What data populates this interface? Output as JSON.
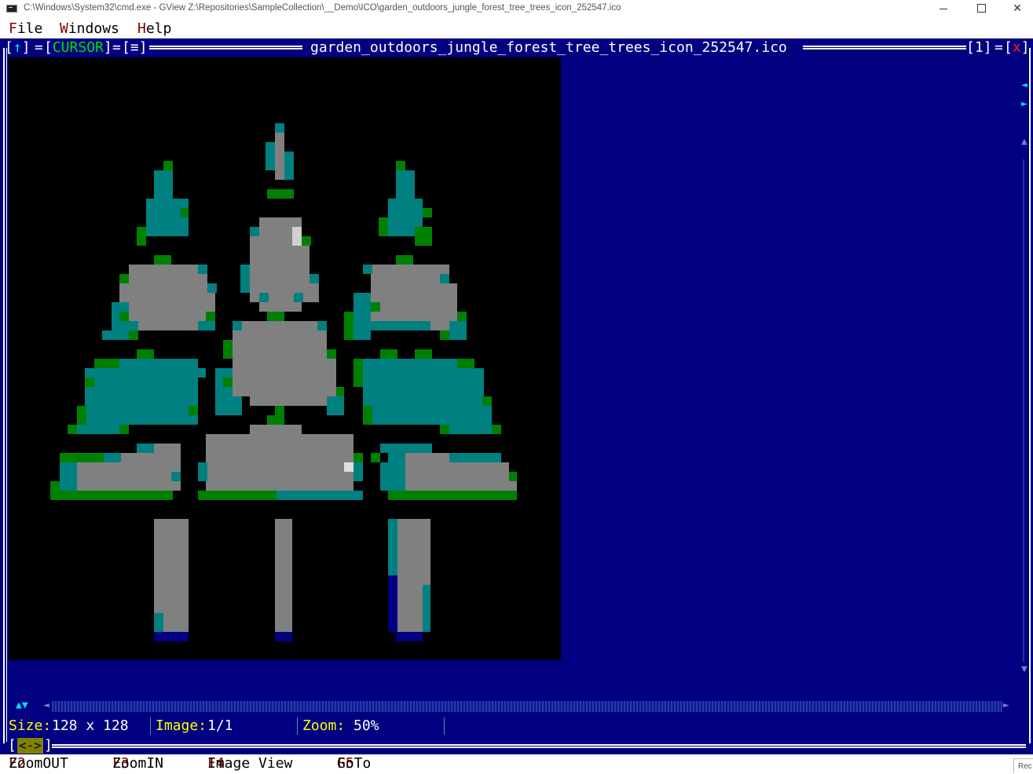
{
  "window": {
    "title": "C:\\Windows\\System32\\cmd.exe - GView  Z:\\Repositories\\SampleCollection\\__Demo\\ICO\\garden_outdoors_jungle_forest_tree_trees_icon_252547.ico",
    "minimize_glyph": "—",
    "maximize_glyph": "",
    "close_glyph": "✕"
  },
  "menu": {
    "file_hot": "F",
    "file_rest": "ile",
    "windows_hot": "W",
    "windows_rest": "indows",
    "help_hot": "H",
    "help_rest": "elp"
  },
  "viewer": {
    "btn_up": "↑",
    "btn_cursor": "CURSOR",
    "btn_menu": "≡",
    "file_name": "garden_outdoors_jungle_forest_tree_trees_icon_252547.ico",
    "window_number": "1",
    "close_glyph": "x",
    "scroll_left": "◄",
    "scroll_right": "►",
    "scroll_up": "▲",
    "scroll_down": "▼",
    "h_arrows": "▲▼",
    "h_left": "◄",
    "h_right": "►",
    "resize_glyph": "<->"
  },
  "status": {
    "size_label": "Size:",
    "size_value": "128 x 128",
    "image_label": "Image:",
    "image_value": "1/1",
    "zoom_label": "Zoom:",
    "zoom_value": "50%"
  },
  "fkeys": [
    {
      "key": "F2",
      "label": "ZoomOUT"
    },
    {
      "key": "F3",
      "label": "ZoomIN"
    },
    {
      "key": "F4",
      "label": "Image View"
    },
    {
      "key": "F5",
      "label": "GoTo"
    }
  ],
  "corner_text": "Rec",
  "colors": {
    "console_bg": "#000080",
    "teal": "#008080",
    "gray": "#808080",
    "green": "#008000",
    "navy": "#000080",
    "hotkey": "#800000",
    "status_label": "#ffff00"
  },
  "icons": {
    "app_icon": "cmd-icon",
    "preview": "pixel-art-trees-icon"
  }
}
